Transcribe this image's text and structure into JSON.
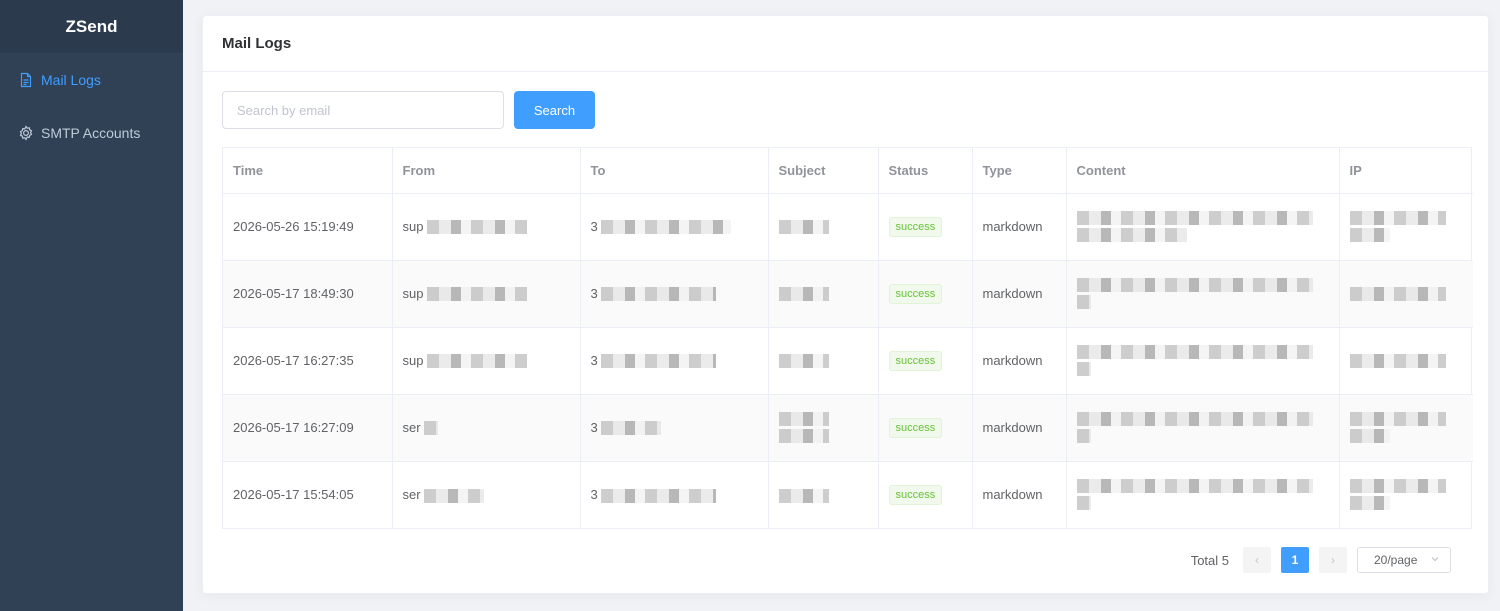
{
  "app": {
    "title": "ZSend"
  },
  "sidebar": {
    "items": [
      {
        "label": "Mail Logs",
        "icon": "document-icon",
        "active": true
      },
      {
        "label": "SMTP Accounts",
        "icon": "gear-icon",
        "active": false
      }
    ]
  },
  "page": {
    "title": "Mail Logs"
  },
  "search": {
    "placeholder": "Search by email",
    "value": "",
    "button_label": "Search"
  },
  "table": {
    "columns": [
      "Time",
      "From",
      "To",
      "Subject",
      "Status",
      "Type",
      "Content",
      "IP"
    ],
    "rows": [
      {
        "time": "2026-05-26 15:19:49",
        "from": "sup",
        "to": "3",
        "status": "success",
        "type": "markdown"
      },
      {
        "time": "2026-05-17 18:49:30",
        "from": "sup",
        "to": "3",
        "status": "success",
        "type": "markdown"
      },
      {
        "time": "2026-05-17 16:27:35",
        "from": "sup",
        "to": "3",
        "status": "success",
        "type": "markdown"
      },
      {
        "time": "2026-05-17 16:27:09",
        "from": "ser",
        "to": "3",
        "status": "success",
        "type": "markdown"
      },
      {
        "time": "2026-05-17 15:54:05",
        "from": "ser",
        "to": "3",
        "status": "success",
        "type": "markdown"
      }
    ]
  },
  "pagination": {
    "total_label": "Total 5",
    "current_page": "1",
    "prev": "‹",
    "next": "›",
    "page_size": "20/page"
  },
  "colors": {
    "sidebar_bg": "#304156",
    "accent": "#409eff",
    "success": "#67c23a"
  }
}
